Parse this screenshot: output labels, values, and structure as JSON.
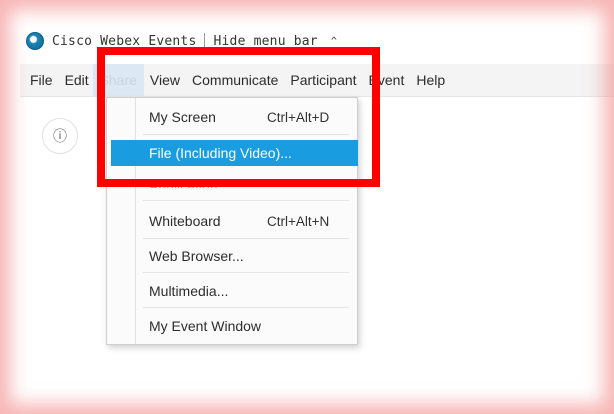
{
  "window": {
    "title": "Cisco Webex Events",
    "hide_menu_label": "Hide menu bar",
    "chevron_icon": "chevron-up-icon",
    "logo_icon": "webex-logo-icon"
  },
  "menubar": {
    "items": [
      {
        "label": "File"
      },
      {
        "label": "Edit"
      },
      {
        "label": "Share"
      },
      {
        "label": "View"
      },
      {
        "label": "Communicate"
      },
      {
        "label": "Participant"
      },
      {
        "label": "Event"
      },
      {
        "label": "Help"
      }
    ],
    "active_item": "Share"
  },
  "rail": {
    "info_icon": "info-icon",
    "info_glyph": "ⓘ"
  },
  "share_menu": {
    "items": [
      {
        "label": "My Screen",
        "shortcut": "Ctrl+Alt+D"
      },
      {
        "label": "File (Including Video)...",
        "shortcut": "",
        "selected": true
      },
      {
        "label": "Application",
        "shortcut": ""
      },
      {
        "label": "Whiteboard",
        "shortcut": "Ctrl+Alt+N"
      },
      {
        "label": "Web Browser...",
        "shortcut": ""
      },
      {
        "label": "Multimedia...",
        "shortcut": ""
      },
      {
        "label": "My Event Window",
        "shortcut": ""
      }
    ]
  },
  "colors": {
    "selection": "#1a9de0",
    "highlight_box": "#ff0000",
    "menubar_bg": "#f4f4f4"
  }
}
